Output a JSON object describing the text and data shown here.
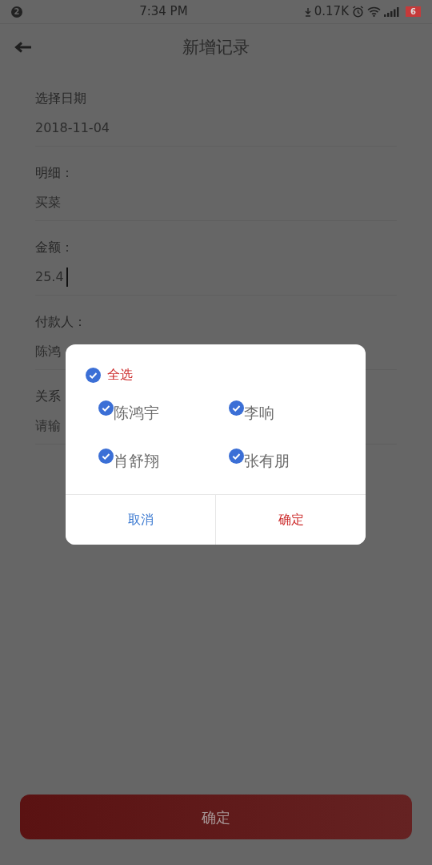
{
  "status_bar": {
    "notification_count": "2",
    "time": "7:34 PM",
    "net_speed": "0.17K",
    "battery": "6"
  },
  "header": {
    "title": "新增记录"
  },
  "fields": [
    {
      "label": "选择日期",
      "value": "2018-11-04",
      "focused": false
    },
    {
      "label": "明细：",
      "value": "买菜",
      "focused": false
    },
    {
      "label": "金额：",
      "value": "25.4",
      "focused": true
    },
    {
      "label": "付款人：",
      "value": "陈鸿",
      "focused": false
    },
    {
      "label": "关系",
      "placeholder": "请输",
      "focused": false
    }
  ],
  "dialog": {
    "select_all": {
      "label": "全选",
      "checked": true
    },
    "options": [
      {
        "label": "陈鸿宇",
        "checked": true
      },
      {
        "label": "李响",
        "checked": true
      },
      {
        "label": "肖舒翔",
        "checked": true
      },
      {
        "label": "张有朋",
        "checked": true
      }
    ],
    "buttons": [
      {
        "label": "取消",
        "kind": "cancel"
      },
      {
        "label": "确定",
        "kind": "confirm"
      }
    ]
  },
  "submit_button": {
    "label": "确定"
  }
}
